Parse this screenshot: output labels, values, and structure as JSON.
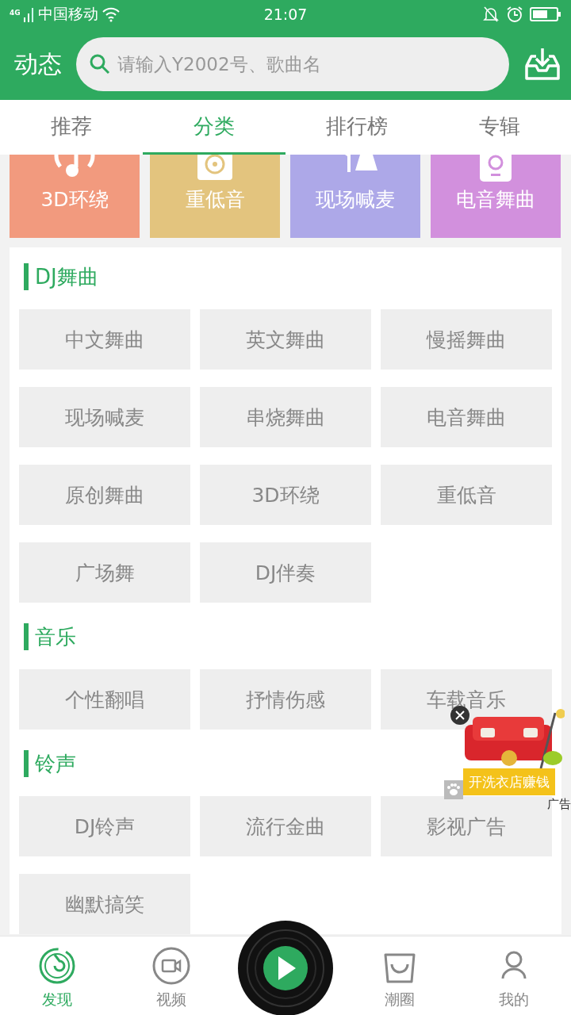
{
  "status_bar": {
    "network": "4G",
    "carrier": "中国移动",
    "time": "21:07"
  },
  "header": {
    "title": "动态",
    "search": {
      "placeholder": "请输入Y2002号、歌曲名"
    }
  },
  "tabs": [
    {
      "label": "推荐",
      "selected": false
    },
    {
      "label": "分类",
      "selected": true
    },
    {
      "label": "排行榜",
      "selected": false
    },
    {
      "label": "专辑",
      "selected": false
    }
  ],
  "featured": [
    {
      "label": "3D环绕",
      "color": "#f29a7e",
      "kind": "surround"
    },
    {
      "label": "重低音",
      "color": "#e3c47e",
      "kind": "bass"
    },
    {
      "label": "现场喊麦",
      "color": "#ada8e8",
      "kind": "live"
    },
    {
      "label": "电音舞曲",
      "color": "#d290dd",
      "kind": "electro"
    }
  ],
  "sections": [
    {
      "title": "DJ舞曲",
      "items": [
        "中文舞曲",
        "英文舞曲",
        "慢摇舞曲",
        "现场喊麦",
        "串烧舞曲",
        "电音舞曲",
        "原创舞曲",
        "3D环绕",
        "重低音",
        "广场舞",
        "DJ伴奏"
      ]
    },
    {
      "title": "音乐",
      "items": [
        "个性翻唱",
        "抒情伤感",
        "车载音乐"
      ]
    },
    {
      "title": "铃声",
      "items": [
        "DJ铃声",
        "流行金曲",
        "影视广告",
        "幽默搞笑"
      ]
    }
  ],
  "ad": {
    "caption": "开洗衣店赚钱",
    "badge": "广告"
  },
  "bottom_nav": [
    {
      "label": "发现",
      "selected": true,
      "kind": "discover"
    },
    {
      "label": "视频",
      "selected": false,
      "kind": "video"
    },
    {
      "kind": "player"
    },
    {
      "label": "潮圈",
      "selected": false,
      "kind": "circle"
    },
    {
      "label": "我的",
      "selected": false,
      "kind": "me"
    }
  ]
}
